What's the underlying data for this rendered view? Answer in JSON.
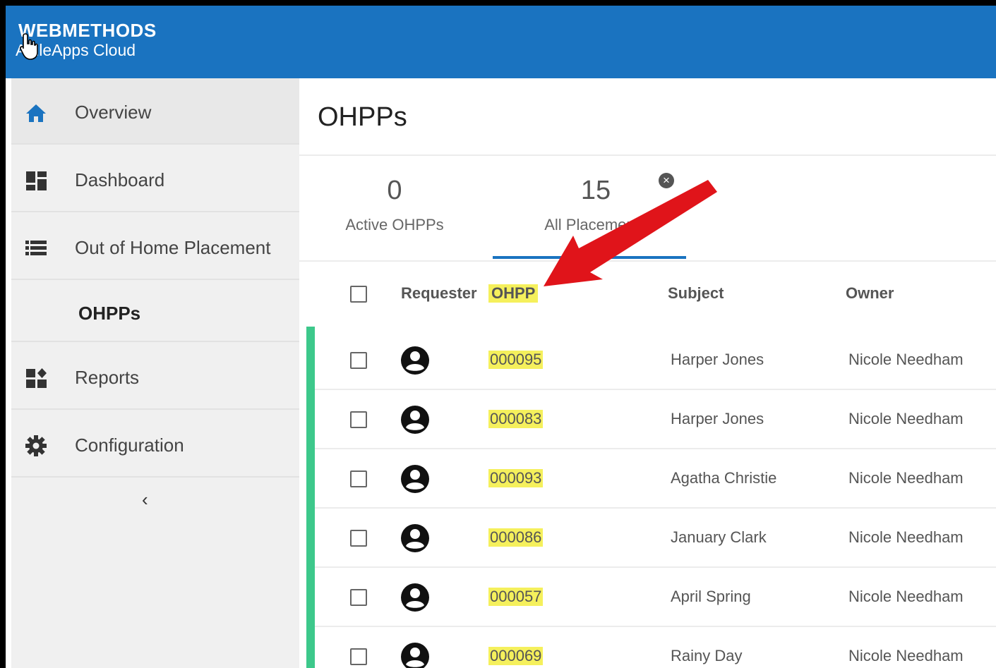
{
  "header": {
    "brand": "WEBMETHODS",
    "subtitle": "AgileApps Cloud"
  },
  "sidebar": {
    "items": [
      {
        "label": "Overview",
        "icon": "home-icon"
      },
      {
        "label": "Dashboard",
        "icon": "dashboard-icon"
      },
      {
        "label": "Out of Home Placement",
        "icon": "list-icon"
      },
      {
        "label": "OHPPs",
        "icon": ""
      },
      {
        "label": "Reports",
        "icon": "reports-icon"
      },
      {
        "label": "Configuration",
        "icon": "gear-icon"
      }
    ],
    "collapse_label": "‹"
  },
  "main": {
    "title": "OHPPs",
    "stats": {
      "active": {
        "count": "0",
        "label": "Active OHPPs"
      },
      "all": {
        "count": "15",
        "label": "All Placements"
      }
    },
    "columns": {
      "requester": "Requester",
      "ohpp": "OHPP",
      "subject": "Subject",
      "owner": "Owner"
    },
    "rows": [
      {
        "ohpp": "000095",
        "subject": "Harper Jones",
        "owner": "Nicole Needham"
      },
      {
        "ohpp": "000083",
        "subject": "Harper Jones",
        "owner": "Nicole Needham"
      },
      {
        "ohpp": "000093",
        "subject": "Agatha Christie",
        "owner": "Nicole Needham"
      },
      {
        "ohpp": "000086",
        "subject": "January Clark",
        "owner": "Nicole Needham"
      },
      {
        "ohpp": "000057",
        "subject": "April Spring",
        "owner": "Nicole Needham"
      },
      {
        "ohpp": "000069",
        "subject": "Rainy Day",
        "owner": "Nicole Needham"
      }
    ]
  },
  "colors": {
    "header_bg": "#1a73c0",
    "highlight": "#f5f05c",
    "row_accent": "#3dc88b",
    "arrow": "#e0141a"
  }
}
